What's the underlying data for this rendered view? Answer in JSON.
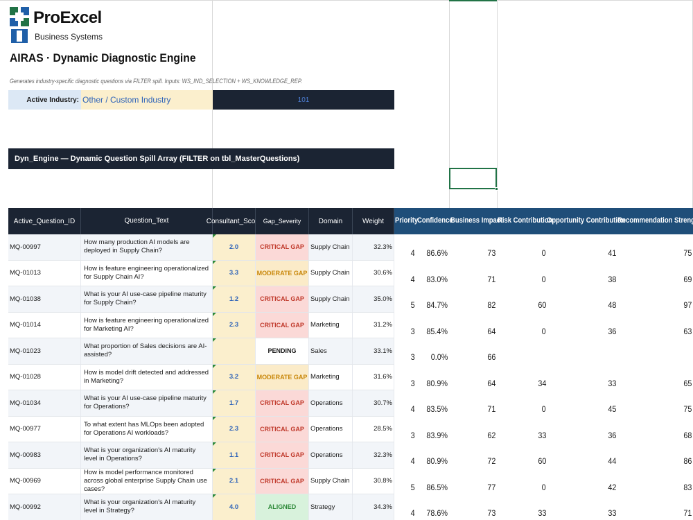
{
  "brand": {
    "name": "ProExcel",
    "tagline": "Business Systems"
  },
  "sheet": {
    "title": "AIRAS · Dynamic Diagnostic Engine",
    "description": "Generates industry-specific diagnostic questions via FILTER spill. Inputs: WS_IND_SELECTION + WS_KNOWLEDGE_REP.",
    "active_industry_label": "Active Industry:",
    "active_industry_value": "Other / Custom Industry",
    "active_industry_code": "101",
    "spill_banner": "Dyn_Engine — Dynamic Question Spill Array (FILTER on tbl_MasterQuestions)"
  },
  "table": {
    "headers": [
      "Active_Question_ID",
      "Question_Text",
      "Consultant_Score",
      "Gap_Severity",
      "Domain",
      "Weight"
    ],
    "rows": [
      {
        "id": "MQ-00997",
        "question": "How many production AI models are deployed in Supply Chain?",
        "score": "2.0",
        "gap": "CRITICAL GAP",
        "gap_type": "critical",
        "domain": "Supply Chain",
        "weight": "32.3%"
      },
      {
        "id": "MQ-01013",
        "question": "How is feature engineering operationalized for Supply Chain AI?",
        "score": "3.3",
        "gap": "MODERATE GAP",
        "gap_type": "moderate",
        "domain": "Supply Chain",
        "weight": "30.6%"
      },
      {
        "id": "MQ-01038",
        "question": "What is your AI use-case pipeline maturity for Supply Chain?",
        "score": "1.2",
        "gap": "CRITICAL GAP",
        "gap_type": "critical",
        "domain": "Supply Chain",
        "weight": "35.0%"
      },
      {
        "id": "MQ-01014",
        "question": "How is feature engineering operationalized for Marketing AI?",
        "score": "2.3",
        "gap": "CRITICAL GAP",
        "gap_type": "critical",
        "domain": "Marketing",
        "weight": "31.2%"
      },
      {
        "id": "MQ-01023",
        "question": "What proportion of Sales decisions are AI-assisted?",
        "score": "",
        "gap": "PENDING",
        "gap_type": "pending",
        "domain": "Sales",
        "weight": "33.1%"
      },
      {
        "id": "MQ-01028",
        "question": "How is model drift detected and addressed in Marketing?",
        "score": "3.2",
        "gap": "MODERATE GAP",
        "gap_type": "moderate",
        "domain": "Marketing",
        "weight": "31.6%"
      },
      {
        "id": "MQ-01034",
        "question": "What is your AI use-case pipeline maturity for Operations?",
        "score": "1.7",
        "gap": "CRITICAL GAP",
        "gap_type": "critical",
        "domain": "Operations",
        "weight": "30.7%"
      },
      {
        "id": "MQ-00977",
        "question": "To what extent has MLOps been adopted for Operations AI workloads?",
        "score": "2.3",
        "gap": "CRITICAL GAP",
        "gap_type": "critical",
        "domain": "Operations",
        "weight": "28.5%"
      },
      {
        "id": "MQ-00983",
        "question": "What is your organization's AI maturity level in Operations?",
        "score": "1.1",
        "gap": "CRITICAL GAP",
        "gap_type": "critical",
        "domain": "Operations",
        "weight": "32.3%"
      },
      {
        "id": "MQ-00969",
        "question": "How is model performance monitored across global enterprise Supply Chain use cases?",
        "score": "2.1",
        "gap": "CRITICAL GAP",
        "gap_type": "critical",
        "domain": "Supply Chain",
        "weight": "30.8%"
      },
      {
        "id": "MQ-00992",
        "question": "What is your organization's AI maturity level in Strategy?",
        "score": "4.0",
        "gap": "ALIGNED",
        "gap_type": "aligned",
        "domain": "Strategy",
        "weight": "34.3%"
      }
    ]
  },
  "metrics": {
    "headers": [
      "Priority",
      "Confidence",
      "Business Impact",
      "Risk Contribution",
      "Opportunity Contribution",
      "Recommendation Strength"
    ],
    "rows": [
      [
        "4",
        "86.6%",
        "73",
        "0",
        "41",
        "75"
      ],
      [
        "4",
        "83.0%",
        "71",
        "0",
        "38",
        "69"
      ],
      [
        "5",
        "84.7%",
        "82",
        "60",
        "48",
        "97"
      ],
      [
        "3",
        "85.4%",
        "64",
        "0",
        "36",
        "63"
      ],
      [
        "3",
        "0.0%",
        "66",
        "",
        "",
        ""
      ],
      [
        "3",
        "80.9%",
        "64",
        "34",
        "33",
        "65"
      ],
      [
        "4",
        "83.5%",
        "71",
        "0",
        "45",
        "75"
      ],
      [
        "3",
        "83.9%",
        "62",
        "33",
        "36",
        "68"
      ],
      [
        "4",
        "80.9%",
        "72",
        "60",
        "44",
        "86"
      ],
      [
        "5",
        "86.5%",
        "77",
        "0",
        "42",
        "83"
      ],
      [
        "4",
        "78.6%",
        "73",
        "33",
        "33",
        "71"
      ]
    ]
  },
  "colors": {
    "header_dark": "#1b2433",
    "metrics_header": "#1f4e79",
    "score_fill": "#fbefcd",
    "critical": "#c0392b",
    "moderate": "#c8870a",
    "aligned": "#2f8a3a",
    "selection": "#217346"
  }
}
